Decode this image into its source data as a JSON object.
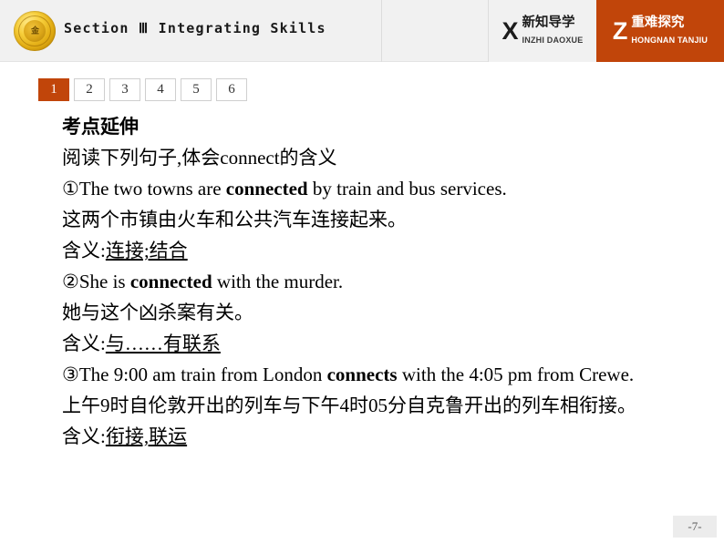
{
  "header": {
    "seal_glyph": "金",
    "section_title": "Section Ⅲ  Integrating Skills",
    "buttons": [
      {
        "letter": "X",
        "cn": "新知导学",
        "en": "INZHI DAOXUE",
        "active": false,
        "bg": "#f1f1f1"
      },
      {
        "letter": "Z",
        "cn": "重难探究",
        "en": "HONGNAN TANJIU",
        "active": true,
        "bg": "#C1450A"
      }
    ]
  },
  "tabs": {
    "active_index": 0,
    "accent": "#C1450A",
    "items": [
      "1",
      "2",
      "3",
      "4",
      "5",
      "6"
    ]
  },
  "content": {
    "heading": "考点延伸",
    "instruction": "阅读下列句子,体会connect的含义",
    "items": [
      {
        "marker": "①",
        "en_pre": "The two towns are ",
        "en_bold": "connected",
        "en_post": " by train and bus services.",
        "cn": "这两个市镇由火车和公共汽车连接起来。",
        "meaning_label": "含义:",
        "meaning_value": "连接;结合"
      },
      {
        "marker": "②",
        "en_pre": "She is ",
        "en_bold": "connected",
        "en_post": " with the murder.",
        "cn": "她与这个凶杀案有关。",
        "meaning_label": "含义:",
        "meaning_value": "与……有联系"
      },
      {
        "marker": "③",
        "en_pre": "The 9:00 am train from London ",
        "en_bold": "connects",
        "en_post": " with the 4:05 pm from Crewe.",
        "cn": "上午9时自伦敦开出的列车与下午4时05分自克鲁开出的列车相衔接。",
        "meaning_label": "含义:",
        "meaning_value": "衔接,联运"
      }
    ]
  },
  "footer": {
    "page_number": "-7-"
  }
}
